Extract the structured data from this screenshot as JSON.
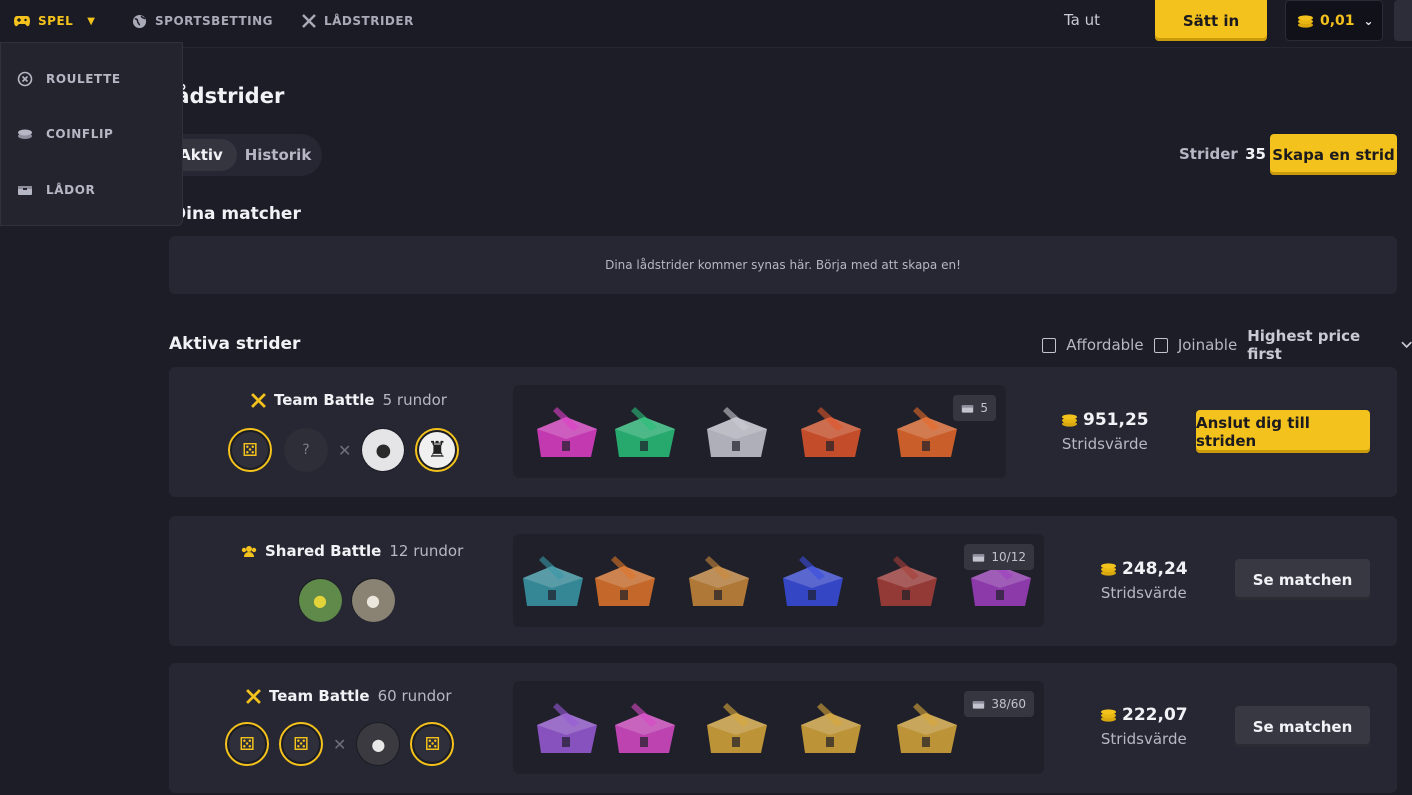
{
  "topbar": {
    "nav": [
      {
        "label": "SPEL",
        "icon": "gamepad-icon",
        "active": true
      },
      {
        "label": "SPORTSBETTING",
        "icon": "globe-icon"
      },
      {
        "label": "LÅDSTRIDER",
        "icon": "crossed-swords-icon"
      }
    ],
    "withdraw_label": "Ta ut",
    "deposit_label": "Sätt in",
    "balance": "0,01"
  },
  "dropdown": {
    "items": [
      {
        "label": "ROULETTE",
        "icon": "roulette-icon"
      },
      {
        "label": "COINFLIP",
        "icon": "coin-icon"
      },
      {
        "label": "LÅDOR",
        "icon": "box-icon"
      }
    ]
  },
  "page": {
    "title": "Lådstrider",
    "tabs": [
      "Aktiv",
      "Historik"
    ],
    "battles_label": "Strider",
    "battles_count": "35",
    "create_label": "Skapa en strid",
    "my_matches_title": "Dina matcher",
    "empty_text": "Dina lådstrider kommer synas här. Börja med att skapa en!",
    "active_title": "Aktiva strider",
    "filters": {
      "affordable": "Affordable",
      "joinable": "Joinable",
      "sort": "Highest price first"
    }
  },
  "battles": [
    {
      "type": "Team Battle",
      "rounds": "5 rundor",
      "case_count": "5",
      "value": "951,25",
      "value_label": "Stridsvärde",
      "action": "Anslut dig till striden",
      "case_colors": [
        "#e040c8",
        "#29c27a",
        "#c9c9d2",
        "#e0562a",
        "#e86a2a"
      ]
    },
    {
      "type": "Shared Battle",
      "rounds": "12 rundor",
      "case_count": "10/12",
      "value": "248,24",
      "value_label": "Stridsvärde",
      "action": "Se matchen",
      "case_colors": [
        "#3a9aa8",
        "#e0762a",
        "#c9883a",
        "#3a4ee0",
        "#a8403a",
        "#a040c0"
      ]
    },
    {
      "type": "Team Battle",
      "rounds": "60 rundor",
      "case_count": "38/60",
      "value": "222,07",
      "value_label": "Stridsvärde",
      "action": "Se matchen",
      "case_colors": [
        "#9a5ad8",
        "#d84ac8",
        "#d8a83a",
        "#d8a83a",
        "#d8a83a"
      ]
    }
  ],
  "colors": {
    "accent": "#f4c21c",
    "bg": "#1c1d26",
    "card": "#262732"
  }
}
